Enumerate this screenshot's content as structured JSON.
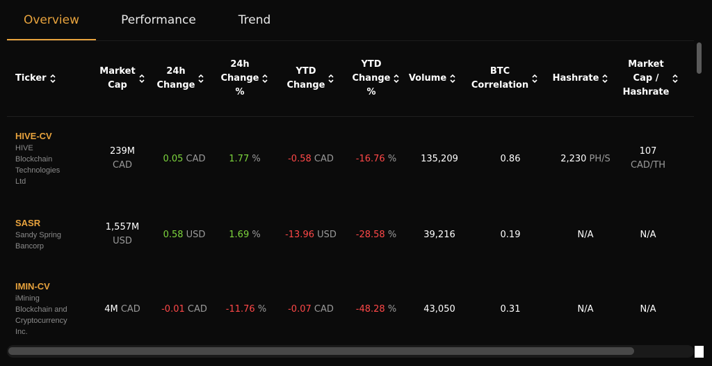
{
  "tabs": [
    {
      "label": "Overview",
      "active": true
    },
    {
      "label": "Performance",
      "active": false
    },
    {
      "label": "Trend",
      "active": false
    }
  ],
  "columns": [
    "Ticker",
    "Market\nCap",
    "24h\nChange",
    "24h\nChange\n%",
    "YTD\nChange",
    "YTD\nChange\n%",
    "Volume",
    "BTC\nCorrelation",
    "Hashrate",
    "Market\nCap /\nHashrate"
  ],
  "rows": [
    {
      "ticker": "HIVE-CV",
      "company": "HIVE Blockchain Technologies Ltd",
      "company_lines": [
        "HIVE",
        "Blockchain",
        "Technologies",
        "Ltd"
      ],
      "market_cap": "239M",
      "market_cap_unit": "CAD",
      "change_24h": "0.05",
      "change_24h_unit": "CAD",
      "change_24h_pct": "1.77",
      "pct_unit": "%",
      "ytd_change": "-0.58",
      "ytd_change_unit": "CAD",
      "ytd_change_pct": "-16.76",
      "volume": "135,209",
      "btc_correlation": "0.86",
      "hashrate": "2,230",
      "hashrate_unit": "PH/S",
      "cap_per_hash": "107",
      "cap_per_hash_unit": "CAD/TH"
    },
    {
      "ticker": "SASR",
      "company": "Sandy Spring Bancorp",
      "company_lines": [
        "Sandy Spring",
        "Bancorp"
      ],
      "market_cap": "1,557M",
      "market_cap_unit": "USD",
      "change_24h": "0.58",
      "change_24h_unit": "USD",
      "change_24h_pct": "1.69",
      "pct_unit": "%",
      "ytd_change": "-13.96",
      "ytd_change_unit": "USD",
      "ytd_change_pct": "-28.58",
      "volume": "39,216",
      "btc_correlation": "0.19",
      "hashrate": "N/A",
      "cap_per_hash": "N/A"
    },
    {
      "ticker": "IMIN-CV",
      "company": "iMining Blockchain and Cryptocurrency Inc.",
      "company_lines": [
        "iMining",
        "Blockchain and",
        "Cryptocurrency",
        "Inc."
      ],
      "market_cap": "4M",
      "market_cap_unit": "CAD",
      "change_24h": "-0.01",
      "change_24h_unit": "CAD",
      "change_24h_pct": "-11.76",
      "pct_unit": "%",
      "ytd_change": "-0.07",
      "ytd_change_unit": "CAD",
      "ytd_change_pct": "-48.28",
      "volume": "43,050",
      "btc_correlation": "0.31",
      "hashrate": "N/A",
      "cap_per_hash": "N/A"
    }
  ],
  "colors": {
    "accent": "#e8a33d",
    "positive": "#7dd63d",
    "negative": "#ff4848",
    "muted": "#9a9a9a",
    "background": "#0b0b0b"
  },
  "icons": {
    "sort": "sort-updown-icon"
  }
}
